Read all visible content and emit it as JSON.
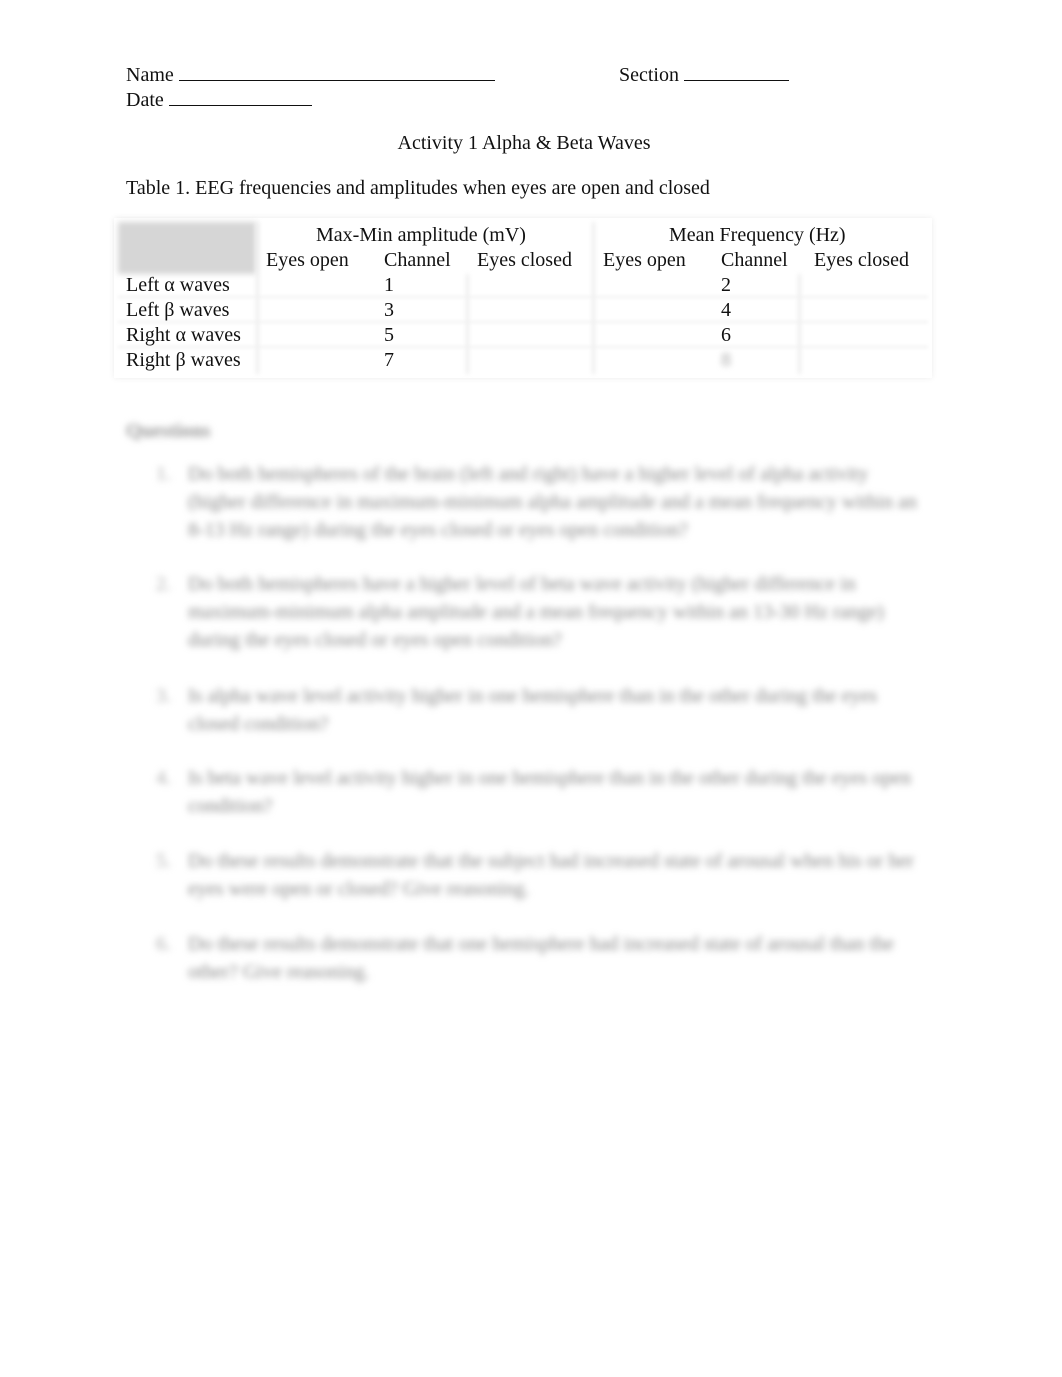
{
  "header": {
    "name_label": "Name",
    "section_label": "Section",
    "date_label": "Date"
  },
  "title": "Activity 1 Alpha & Beta Waves",
  "table": {
    "caption": "Table 1. EEG frequencies and amplitudes when eyes are open and closed",
    "groups": [
      {
        "label": "Max-Min amplitude (mV)"
      },
      {
        "label": "Mean Frequency (Hz)"
      }
    ],
    "subheaders": [
      "Eyes open",
      "Channel",
      "Eyes closed",
      "Eyes open",
      "Channel",
      "Eyes closed"
    ],
    "rows": [
      {
        "label": "Left α waves",
        "amp_open": "",
        "amp_channel": "1",
        "amp_closed": "",
        "freq_open": "",
        "freq_channel": "2",
        "freq_closed": ""
      },
      {
        "label": "Left β waves",
        "amp_open": "",
        "amp_channel": "3",
        "amp_closed": "",
        "freq_open": "",
        "freq_channel": "4",
        "freq_closed": ""
      },
      {
        "label": "Right α waves",
        "amp_open": "",
        "amp_channel": "5",
        "amp_closed": "",
        "freq_open": "",
        "freq_channel": "6",
        "freq_closed": ""
      },
      {
        "label": "Right β waves",
        "amp_open": "",
        "amp_channel": "7",
        "amp_closed": "",
        "freq_open": "",
        "freq_channel": "8",
        "freq_closed": ""
      }
    ]
  },
  "questions": {
    "heading": "Questions",
    "items": [
      {
        "num": "1.",
        "text": "Do both hemispheres of the brain (left and right) have a higher level of alpha activity (higher difference in maximum-minimum alpha amplitude and a mean frequency within an 8-13 Hz range) during the eyes closed or eyes open condition?"
      },
      {
        "num": "2.",
        "text": "Do both hemispheres have a higher level of beta wave activity (higher difference in maximum-minimum alpha amplitude and a mean frequency within an 13-30 Hz range) during the eyes closed or eyes open condition?"
      },
      {
        "num": "3.",
        "text": "Is alpha wave level activity higher in one hemisphere than in the other during the eyes closed condition?"
      },
      {
        "num": "4.",
        "text": "Is beta wave level activity higher in one hemisphere than in the other during the eyes open condition?"
      },
      {
        "num": "5.",
        "text": "Do these results demonstrate that the subject had increased state of arousal when his or her eyes were open or closed? Give reasoning."
      },
      {
        "num": "6.",
        "text": "Do these results demonstrate that one hemisphere had increased state of arousal than the other? Give reasoning."
      }
    ]
  }
}
